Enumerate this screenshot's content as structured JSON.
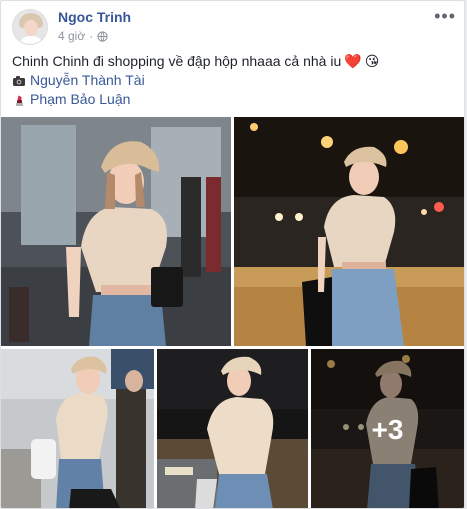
{
  "post": {
    "author": "Ngoc Trinh",
    "time": "4 giờ",
    "privacy_dot": "·",
    "more_label": "•••",
    "caption": "Chinh Chinh đi shopping về đập hộp nhaaa cả nhà iu",
    "caption_emojis": [
      "❤️",
      "😘"
    ],
    "credits": [
      {
        "icon": "camera-icon",
        "name": "Nguyễn Thành Tài"
      },
      {
        "icon": "lipstick-icon",
        "name": "Phạm Bảo Luận"
      }
    ],
    "photos": {
      "extra_count_label": "+3"
    }
  },
  "colors": {
    "link": "#385898",
    "text": "#1d2129",
    "meta": "#90949c",
    "border": "#dddfe2"
  }
}
